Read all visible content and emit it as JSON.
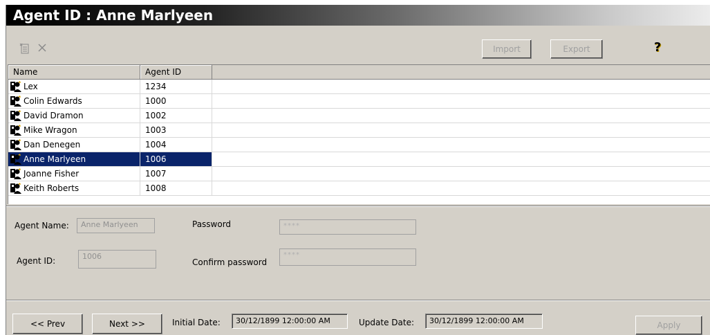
{
  "window": {
    "title": "Agent ID  : Anne Marlyeen"
  },
  "toolbar": {
    "new_icon": "new-document-icon",
    "delete_icon": "delete-x-icon",
    "import_label": "Import",
    "export_label": "Export",
    "help_icon": "question-mark-icon"
  },
  "grid": {
    "columns": [
      "Name",
      "Agent ID"
    ],
    "rows": [
      {
        "name": "Lex",
        "agent_id": "1234",
        "selected": false
      },
      {
        "name": "Colin Edwards",
        "agent_id": "1000",
        "selected": false
      },
      {
        "name": "David Dramon",
        "agent_id": "1002",
        "selected": false
      },
      {
        "name": "Mike Wragon",
        "agent_id": "1003",
        "selected": false
      },
      {
        "name": "Dan Denegen",
        "agent_id": "1004",
        "selected": false
      },
      {
        "name": "Anne Marlyeen",
        "agent_id": "1006",
        "selected": true
      },
      {
        "name": "Joanne Fisher",
        "agent_id": "1007",
        "selected": false
      },
      {
        "name": "Keith Roberts",
        "agent_id": "1008",
        "selected": false
      }
    ]
  },
  "form": {
    "agent_name_label": "Agent Name:",
    "agent_name_value": "Anne Marlyeen",
    "agent_id_label": "Agent ID:",
    "agent_id_value": "1006",
    "password_label": "Password",
    "password_value": "****",
    "confirm_label": "Confirm password",
    "confirm_value": "****"
  },
  "footer": {
    "prev_label": "<< Prev",
    "next_label": "Next >>",
    "initial_date_label": "Initial Date:",
    "initial_date_value": "30/12/1899 12:00:00 AM",
    "update_date_label": "Update Date:",
    "update_date_value": "30/12/1899 12:00:00 AM",
    "apply_label": "Apply"
  },
  "colors": {
    "selection": "#0a246a",
    "window_bg": "#d4d0c8"
  }
}
